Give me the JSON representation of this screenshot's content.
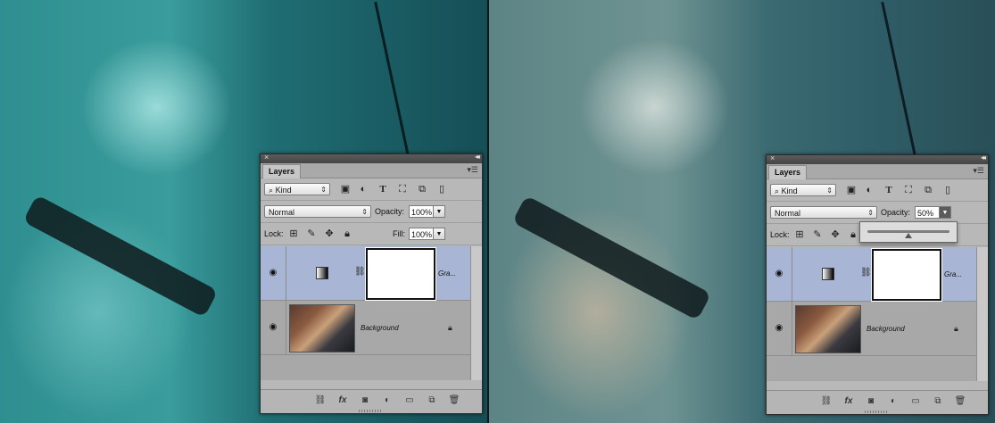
{
  "panels": [
    {
      "tab_title": "Layers",
      "filter_kind": "Kind",
      "blend_mode": "Normal",
      "opacity_label": "Opacity:",
      "opacity_value": "100%",
      "lock_label": "Lock:",
      "fill_label": "Fill:",
      "fill_value": "100%",
      "layers": [
        {
          "name": "Gra...",
          "type": "gradient-map-adjustment",
          "selected": true
        },
        {
          "name": "Background",
          "type": "image",
          "selected": false
        }
      ]
    },
    {
      "tab_title": "Layers",
      "filter_kind": "Kind",
      "blend_mode": "Normal",
      "opacity_label": "Opacity:",
      "opacity_value": "50%",
      "opacity_slider_fraction": 0.5,
      "lock_label": "Lock:",
      "layers": [
        {
          "name": "Gra...",
          "type": "gradient-map-adjustment",
          "selected": true
        },
        {
          "name": "Background",
          "type": "image",
          "selected": false
        }
      ]
    }
  ],
  "icons": {
    "filter_tools": [
      "image-filter-icon",
      "adjustment-filter-icon",
      "type-filter-icon",
      "shape-filter-icon",
      "smart-object-filter-icon",
      "filter-toggle-icon"
    ],
    "lock_tools": [
      "lock-transparent-icon",
      "lock-image-icon",
      "lock-position-icon",
      "lock-all-icon"
    ],
    "footer": [
      "link-layers-icon",
      "fx-icon",
      "add-mask-icon",
      "new-adjustment-icon",
      "new-group-icon",
      "new-layer-icon",
      "trash-icon"
    ]
  }
}
